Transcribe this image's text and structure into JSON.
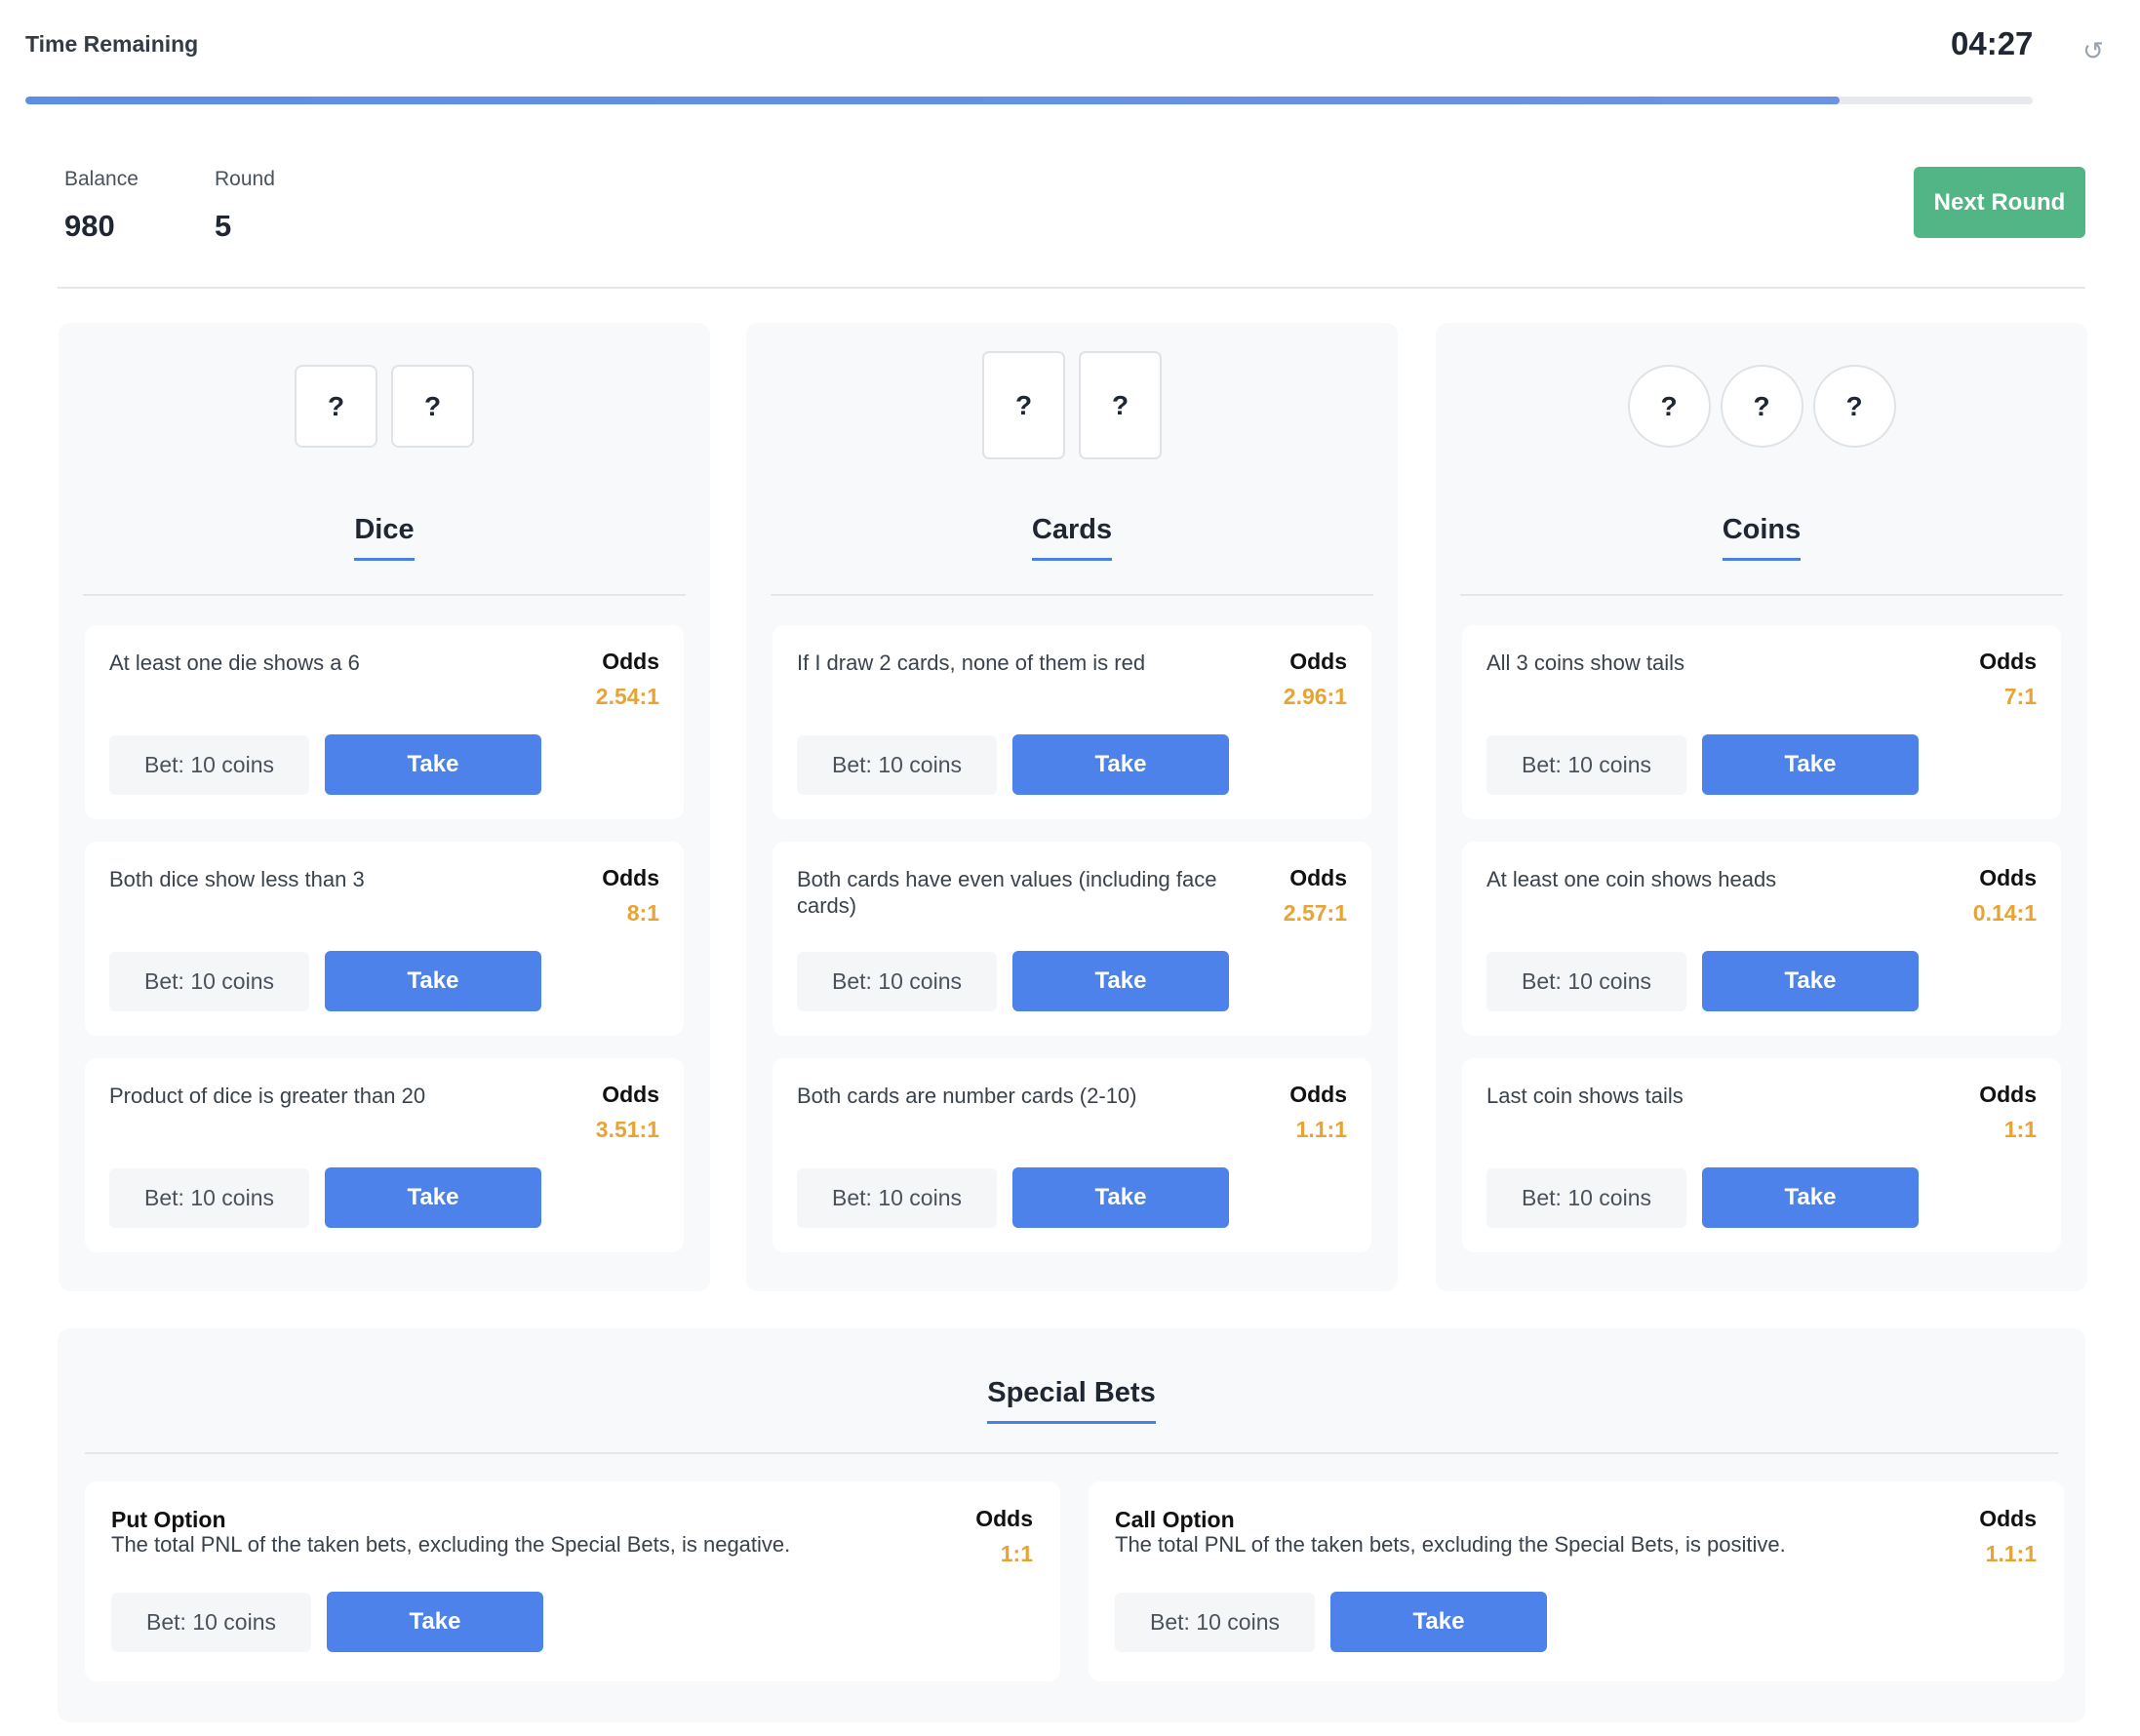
{
  "timer": {
    "label": "Time Remaining",
    "value": "04:27",
    "progress_percent": 90.4
  },
  "stats": {
    "balance_label": "Balance",
    "balance": "980",
    "round_label": "Round",
    "round": "5"
  },
  "next_round_label": "Next Round",
  "colors": {
    "accent": "#4d82ea",
    "success": "#52b585",
    "odds": "#e8a335"
  },
  "panels": [
    {
      "title": "Dice",
      "tokens": [
        "?",
        "?"
      ],
      "bets": [
        {
          "desc": "At least one die shows a 6",
          "odds_label": "Odds",
          "odds": "2.54:1",
          "bet": "Bet: 10 coins",
          "take": "Take"
        },
        {
          "desc": "Both dice show less than 3",
          "odds_label": "Odds",
          "odds": "8:1",
          "bet": "Bet: 10 coins",
          "take": "Take"
        },
        {
          "desc": "Product of dice is greater than 20",
          "odds_label": "Odds",
          "odds": "3.51:1",
          "bet": "Bet: 10 coins",
          "take": "Take"
        }
      ]
    },
    {
      "title": "Cards",
      "tokens": [
        "?",
        "?"
      ],
      "bets": [
        {
          "desc": "If I draw 2 cards, none of them is red",
          "odds_label": "Odds",
          "odds": "2.96:1",
          "bet": "Bet: 10 coins",
          "take": "Take"
        },
        {
          "desc": "Both cards have even values (including face cards)",
          "odds_label": "Odds",
          "odds": "2.57:1",
          "bet": "Bet: 10 coins",
          "take": "Take"
        },
        {
          "desc": "Both cards are number cards (2-10)",
          "odds_label": "Odds",
          "odds": "1.1:1",
          "bet": "Bet: 10 coins",
          "take": "Take"
        }
      ]
    },
    {
      "title": "Coins",
      "tokens": [
        "?",
        "?",
        "?"
      ],
      "bets": [
        {
          "desc": "All 3 coins show tails",
          "odds_label": "Odds",
          "odds": "7:1",
          "bet": "Bet: 10 coins",
          "take": "Take"
        },
        {
          "desc": "At least one coin shows heads",
          "odds_label": "Odds",
          "odds": "0.14:1",
          "bet": "Bet: 10 coins",
          "take": "Take"
        },
        {
          "desc": "Last coin shows tails",
          "odds_label": "Odds",
          "odds": "1:1",
          "bet": "Bet: 10 coins",
          "take": "Take"
        }
      ]
    }
  ],
  "special": {
    "title": "Special Bets",
    "bets": [
      {
        "name": "Put Option",
        "desc": "The total PNL of the taken bets, excluding the Special Bets, is negative.",
        "odds_label": "Odds",
        "odds": "1:1",
        "bet": "Bet: 10 coins",
        "take": "Take"
      },
      {
        "name": "Call Option",
        "desc": "The total PNL of the taken bets, excluding the Special Bets, is positive.",
        "odds_label": "Odds",
        "odds": "1.1:1",
        "bet": "Bet: 10 coins",
        "take": "Take"
      }
    ]
  }
}
